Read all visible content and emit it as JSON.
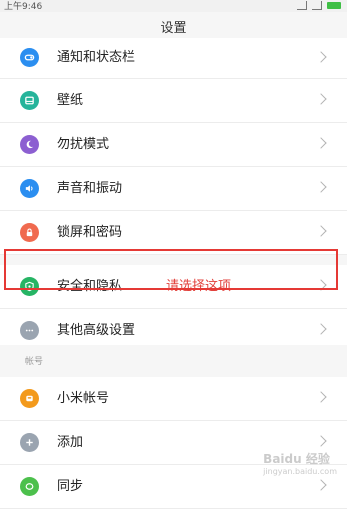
{
  "status_bar": {
    "time": "上午9:46"
  },
  "header": {
    "title": "设置"
  },
  "rows": [
    {
      "label": "通知和状态栏",
      "icon": "notification-icon",
      "color": "#2b8ef0"
    },
    {
      "label": "壁纸",
      "icon": "wallpaper-icon",
      "color": "#26b49b"
    },
    {
      "label": "勿扰模式",
      "icon": "moon-icon",
      "color": "#8c5fd1"
    },
    {
      "label": "声音和振动",
      "icon": "speaker-icon",
      "color": "#2b8ef0"
    },
    {
      "label": "锁屏和密码",
      "icon": "lock-icon",
      "color": "#f06a4f"
    },
    {
      "label": "安全和隐私",
      "icon": "shield-icon",
      "color": "#26b464",
      "annotation": "请选择这项"
    },
    {
      "label": "其他高级设置",
      "icon": "more-icon",
      "color": "#9aa4b0"
    }
  ],
  "accounts_section": {
    "title": "帐号",
    "rows": [
      {
        "label": "小米帐号",
        "icon": "mi-account-icon",
        "color": "#f39a1c"
      },
      {
        "label": "添加",
        "icon": "add-icon",
        "color": "#9aa4b0"
      },
      {
        "label": "同步",
        "icon": "sync-icon",
        "color": "#4cc04c"
      }
    ]
  },
  "watermark": {
    "main": "Baidu 经验",
    "sub": "jingyan.baidu.com"
  },
  "colors": {
    "highlight_border": "#e53935",
    "annotation_text": "#e2413c"
  }
}
